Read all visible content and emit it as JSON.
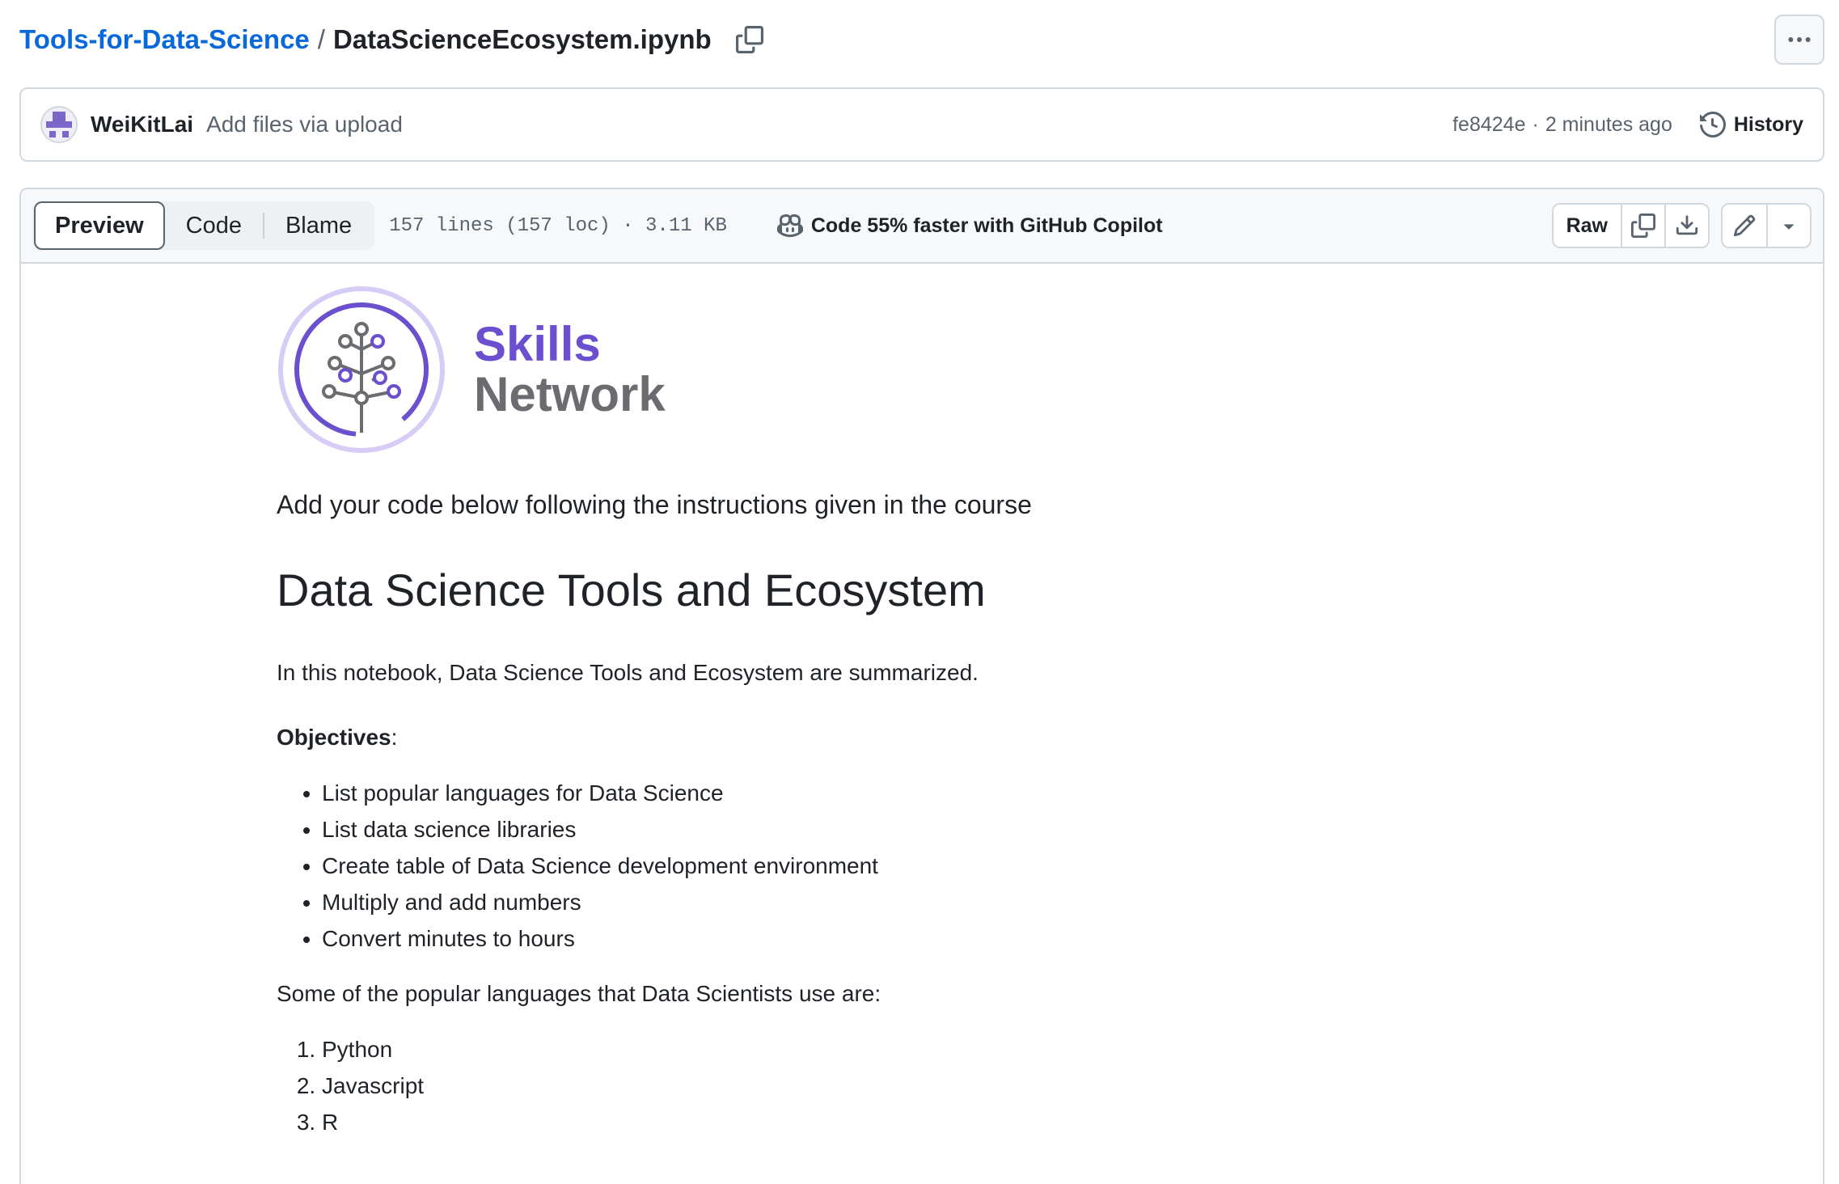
{
  "breadcrumb": {
    "repo": "Tools-for-Data-Science",
    "separator": "/",
    "file": "DataScienceEcosystem.ipynb"
  },
  "commit": {
    "author": "WeiKitLai",
    "message": "Add files via upload",
    "sha": "fe8424e",
    "separator": "·",
    "time": "2 minutes ago",
    "history_label": "History"
  },
  "file_header": {
    "tabs": [
      {
        "label": "Preview",
        "active": true
      },
      {
        "label": "Code",
        "active": false
      },
      {
        "label": "Blame",
        "active": false
      }
    ],
    "meta": "157 lines (157 loc) · 3.11 KB",
    "copilot_text": "Code 55% faster with GitHub Copilot",
    "raw_label": "Raw"
  },
  "notebook": {
    "logo": {
      "line1": "Skills",
      "line2": "Network"
    },
    "intro": "Add your code below following the instructions given in the course",
    "heading": "Data Science Tools and Ecosystem",
    "summary": "In this notebook, Data Science Tools and Ecosystem are summarized.",
    "objectives_label": "Objectives",
    "objectives_suffix": ":",
    "objectives": [
      "List popular languages for Data Science",
      "List data science libraries",
      "Create table of Data Science development environment",
      "Multiply and add numbers",
      "Convert minutes to hours"
    ],
    "languages_intro": "Some of the popular languages that Data Scientists use are:",
    "languages": [
      "Python",
      "Javascript",
      "R"
    ]
  },
  "colors": {
    "link": "#0969da",
    "brand_purple": "#6b4fcf",
    "border": "#d1d9e0",
    "muted": "#59636e"
  },
  "icons": {
    "copy_path": "copy-icon",
    "more": "kebab-horizontal-icon",
    "history": "history-icon",
    "copilot": "copilot-icon",
    "copy_raw": "copy-icon",
    "download": "download-icon",
    "edit": "pencil-icon",
    "more_edit": "triangle-down-icon"
  }
}
